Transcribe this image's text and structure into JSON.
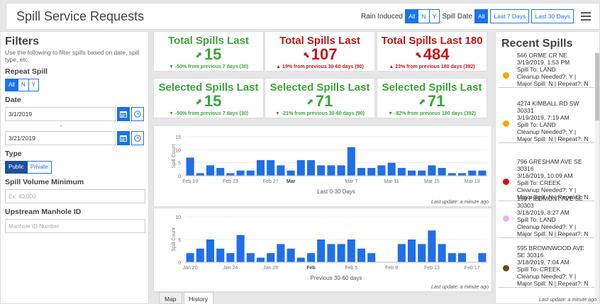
{
  "header": {
    "title": "Spill Service Requests",
    "rain_label": "Rain Induced",
    "rain_options": [
      "All",
      "N",
      "Y"
    ],
    "date_label": "Spill Date",
    "date_options": [
      "All",
      "Last 7 Days",
      "Last 30 Days"
    ]
  },
  "filters": {
    "title": "Filters",
    "description": "Use the following to filter spills based on date, spill type, etc.",
    "repeat_label": "Repeat Spill",
    "repeat_options": [
      "All",
      "N",
      "Y"
    ],
    "date_label": "Date",
    "date_from": "3/1/2019",
    "date_separator": "-",
    "date_to": "3/21/2019",
    "type_label": "Type",
    "type_options": [
      "Public",
      "Private"
    ],
    "volume_label": "Spill Volume Minimum",
    "volume_placeholder": "Ex: 40,000",
    "manhole_label": "Upstream Manhole ID",
    "manhole_placeholder": "Manhole ID Number"
  },
  "metrics": [
    {
      "title": "Total Spills Last",
      "value": "15",
      "change": "▼ -50% from previous 7 days (30)",
      "color": "#3aa53a"
    },
    {
      "title": "Total Spills Last",
      "value": "107",
      "change": "▲ 19% from previous 30-60 days (90)",
      "color": "#c0161a"
    },
    {
      "title": "Total Spills Last 180",
      "value": "484",
      "change": "▲ 23% from previous 180 days (392)",
      "color": "#c0161a"
    },
    {
      "title": "Selected Spills Last",
      "value": "15",
      "change": "▼ -50% from previous 7 days (30)",
      "color": "#3aa53a"
    },
    {
      "title": "Selected Spills Last",
      "value": "71",
      "change": "▼ -21% from previous 30-60 days (90)",
      "color": "#3aa53a"
    },
    {
      "title": "Selected Spills Last",
      "value": "71",
      "change": "▼ -82% from previous 180 days (392)",
      "color": "#3aa53a"
    }
  ],
  "chart_data": [
    {
      "type": "bar",
      "ylabel": "Spill Count",
      "xlabel": "Last 0-30 Days",
      "ylim": [
        0,
        15
      ],
      "yticks": [
        "0",
        "5",
        "10",
        "15"
      ],
      "xticks": [
        {
          "label": "Feb 19",
          "i": 0,
          "bold": false
        },
        {
          "label": "Feb 23",
          "i": 4,
          "bold": false
        },
        {
          "label": "Feb 27",
          "i": 8,
          "bold": false
        },
        {
          "label": "Mar",
          "i": 10,
          "bold": true
        },
        {
          "label": "Mar 7",
          "i": 16,
          "bold": false
        },
        {
          "label": "Mar 11",
          "i": 20,
          "bold": false
        },
        {
          "label": "Mar 15",
          "i": 24,
          "bold": false
        },
        {
          "label": "Mar 19",
          "i": 28,
          "bold": false
        }
      ],
      "values": [
        7,
        1,
        4,
        3,
        1,
        2,
        2,
        6,
        6,
        4,
        2,
        6,
        6,
        4,
        4,
        4,
        11,
        3,
        3,
        4,
        5,
        3,
        2,
        2,
        4,
        3,
        1,
        1,
        2,
        2
      ],
      "color": "#1f6fe8",
      "update_text": "Last update: a minute ago"
    },
    {
      "type": "bar",
      "ylabel": "Spill Count",
      "xlabel": "Previous 30-60 days",
      "ylim": [
        0,
        10
      ],
      "yticks": [
        "0",
        "5",
        "10"
      ],
      "xticks": [
        {
          "label": "Jan 20",
          "i": 0,
          "bold": false
        },
        {
          "label": "Jan 24",
          "i": 4,
          "bold": false
        },
        {
          "label": "Jan 28",
          "i": 8,
          "bold": false
        },
        {
          "label": "Feb",
          "i": 12,
          "bold": true
        },
        {
          "label": "Feb 5",
          "i": 16,
          "bold": false
        },
        {
          "label": "Feb 9",
          "i": 20,
          "bold": false
        },
        {
          "label": "Feb 13",
          "i": 24,
          "bold": false
        },
        {
          "label": "Feb 17",
          "i": 28,
          "bold": false
        }
      ],
      "values": [
        2,
        3,
        5,
        3,
        2,
        6,
        2,
        1,
        2,
        4,
        3,
        1,
        2,
        5,
        4,
        4,
        5,
        3,
        2,
        0,
        0,
        4,
        5,
        4,
        7,
        4,
        2,
        2,
        0,
        2
      ],
      "color": "#1f6fe8",
      "update_text": "Last update: a minute ago"
    }
  ],
  "tabs": [
    "Map",
    "History"
  ],
  "recent": {
    "title": "Recent Spills",
    "items": [
      {
        "text": "566 ORME CR NE\n3/19/2019, 1:53 PM\nSpill To: LAND\nCleanup Needed?: Y |\nMajor Spill: N | Repeat?: N",
        "color": "#f5a800"
      },
      {
        "text": "4274 KIMBALL RD SW\n30331\n3/19/2019, 7:19 AM\nSpill To: LAND\nCleanup Needed?: Y |\nMajor Spill: N | Repeat?: N",
        "color": "#f5a800"
      },
      {
        "text": "796 GRESHAM AVE SE\n30316\n3/18/2019, 10:09 AM\nSpill To: CREEK\nCleanup Needed?: Y |\nMajor Spill: N | Repeat?: N",
        "color": "#e8001c"
      },
      {
        "text": "160 PIEDMONT AVE SE\n30303\n3/18/2019, 8:27 AM\nSpill To: LAND\nCleanup Needed?: Y |\nMajor Spill: N | Repeat?: N",
        "color": "#e8b4f0"
      },
      {
        "text": "595 BROWNWOOD AVE\nSE 30316\n3/18/2019, 7:04 AM\nSpill To: CREEK\nCleanup Needed?: Y |\nMajor Spill: N | Repeat?: N",
        "color": "#6b4a12"
      }
    ],
    "update_text": "Last update: a minute ago"
  }
}
